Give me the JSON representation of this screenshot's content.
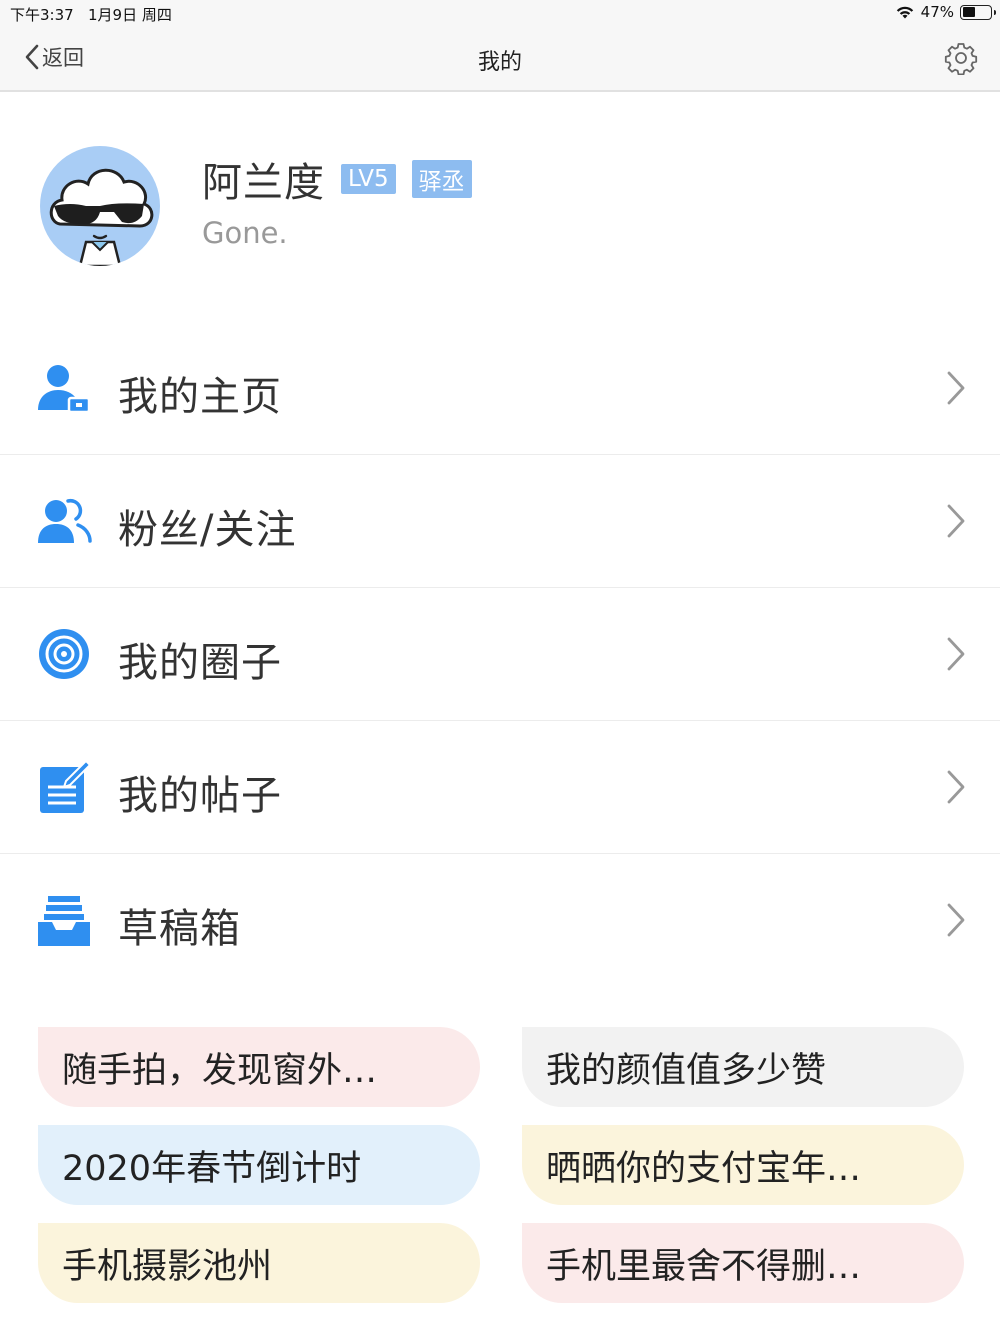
{
  "status": {
    "time": "下午3:37",
    "date": "1月9日 周四",
    "battery": "47%",
    "battery_level": 0.47
  },
  "nav": {
    "back_label": "返回",
    "title": "我的"
  },
  "profile": {
    "name": "阿兰度",
    "level_badge": "LV5",
    "title_badge": "驿丞",
    "signature": "Gone."
  },
  "menu": [
    {
      "label": "我的主页",
      "icon": "person-card-icon"
    },
    {
      "label": "粉丝/关注",
      "icon": "two-persons-icon"
    },
    {
      "label": "我的圈子",
      "icon": "circle-target-icon"
    },
    {
      "label": "我的帖子",
      "icon": "edit-doc-icon"
    },
    {
      "label": "草稿箱",
      "icon": "inbox-tray-icon"
    }
  ],
  "tags": [
    {
      "text": "随手拍，发现窗外…",
      "color": "#fbeaea"
    },
    {
      "text": "我的颜值值多少赞",
      "color": "#f2f2f2"
    },
    {
      "text": "2020年春节倒计时",
      "color": "#e2f0fb"
    },
    {
      "text": "晒晒你的支付宝年…",
      "color": "#fbf4dc"
    },
    {
      "text": "手机摄影池州",
      "color": "#fbf4dc"
    },
    {
      "text": "手机里最舍不得删…",
      "color": "#fbeaea"
    }
  ],
  "colors": {
    "accent": "#2f8ff0",
    "badge": "#8dbcf0"
  }
}
